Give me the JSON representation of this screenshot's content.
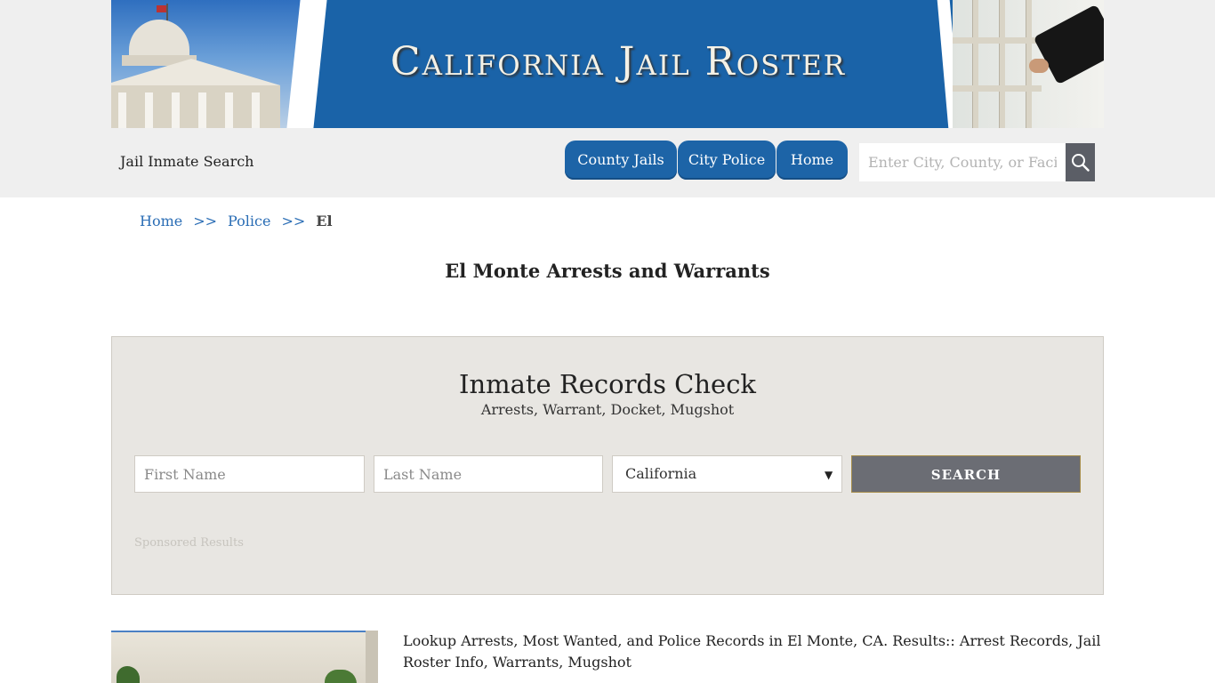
{
  "header": {
    "banner_title": "California Jail Roster",
    "site_label": "Jail Inmate Search"
  },
  "nav": {
    "tabs": [
      {
        "label": "County Jails"
      },
      {
        "label": "City Police"
      },
      {
        "label": "Home"
      }
    ],
    "search": {
      "placeholder": "Enter City, County, or Facility"
    }
  },
  "breadcrumb": {
    "items": [
      "Home",
      "Police",
      "El"
    ],
    "separator": ">>"
  },
  "page": {
    "title": "El Monte Arrests and Warrants"
  },
  "records_panel": {
    "title": "Inmate Records Check",
    "subtitle": "Arrests, Warrant, Docket, Mugshot",
    "first_name_placeholder": "First Name",
    "last_name_placeholder": "Last Name",
    "state_selected": "California",
    "search_label": "SEARCH",
    "sponsored": "Sponsored Results"
  },
  "content": {
    "description": "Lookup Arrests, Most Wanted, and Police Records in El Monte, CA. Results:: Arrest Records, Jail Roster Info, Warrants, Mugshot"
  },
  "colors": {
    "brand_blue": "#1d64a7",
    "panel_bg": "#e8e6e2",
    "search_button": "#6b6d74",
    "link": "#2a6db5"
  },
  "icons": {
    "search_button": "magnifier-icon",
    "state_dropdown": "chevron-down-icon"
  }
}
